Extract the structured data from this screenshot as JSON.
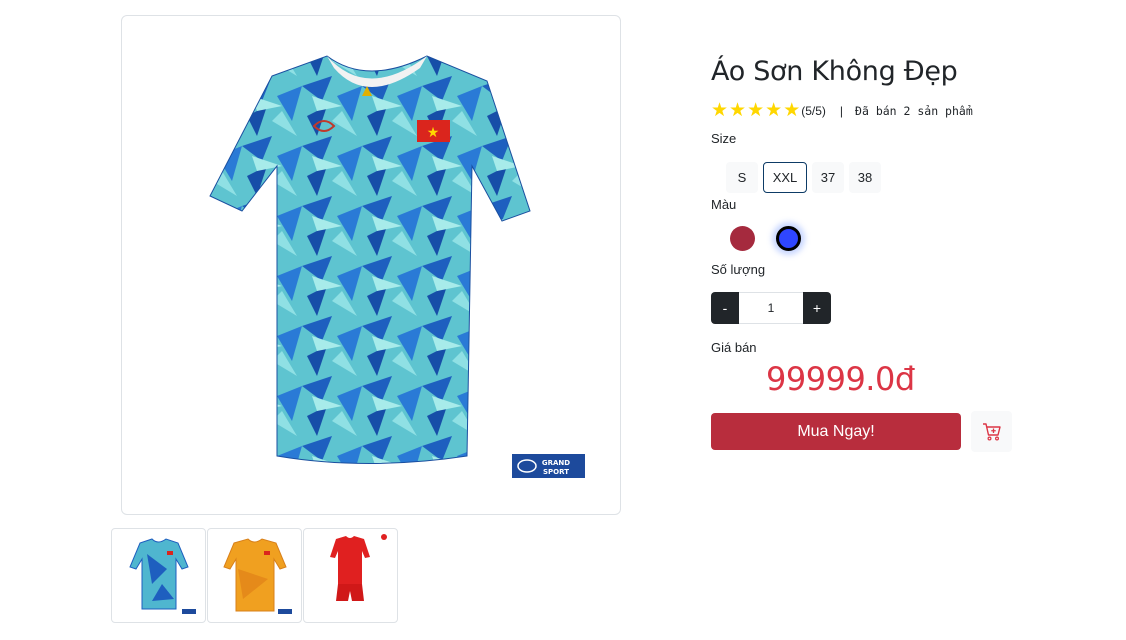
{
  "product": {
    "title": "Áo Sơn Không Đẹp",
    "rating_stars": 5,
    "rating_text": "(5/5)",
    "separator": "|",
    "sold_text": "Đã bán 2 sản phẩm",
    "main_image_icon": "blue-patterned-jersey-image",
    "thumbnails": [
      {
        "icon": "blue-jersey-thumbnail"
      },
      {
        "icon": "yellow-jersey-thumbnail"
      },
      {
        "icon": "red-kit-thumbnail"
      }
    ]
  },
  "size": {
    "label": "Size",
    "options": [
      "S",
      "XXL",
      "37",
      "38"
    ],
    "selected": "XXL"
  },
  "color": {
    "label": "Màu",
    "options": [
      {
        "name": "red",
        "hex": "#a52a3e"
      },
      {
        "name": "blue",
        "hex": "#2f46ff"
      }
    ],
    "selected": "blue"
  },
  "quantity": {
    "label": "Số lượng",
    "minus_label": "-",
    "plus_label": "+",
    "value": "1"
  },
  "price": {
    "label": "Giá bán",
    "value": "99999.0đ"
  },
  "actions": {
    "buy_label": "Mua Ngay!",
    "cart_icon": "add-to-cart-icon"
  },
  "colors": {
    "accent": "#dc3545",
    "buy_button": "#b82d3d",
    "star": "#ffd700"
  }
}
